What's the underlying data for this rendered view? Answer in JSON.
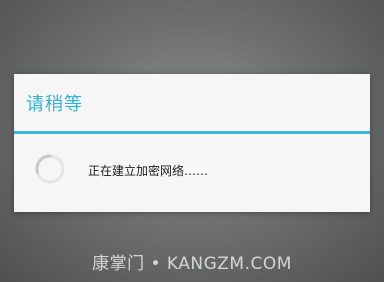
{
  "dialog": {
    "title": "请稍等",
    "message": "正在建立加密网络……"
  },
  "watermark": {
    "text": "康掌门 • KANGZM.COM"
  },
  "icons": {
    "spinner": "loading-spinner-icon"
  },
  "colors": {
    "accent": "#3ab8dc",
    "title": "#2fb4d6",
    "dialog_bg": "#f6f6f6",
    "overlay": "#6f7170"
  }
}
